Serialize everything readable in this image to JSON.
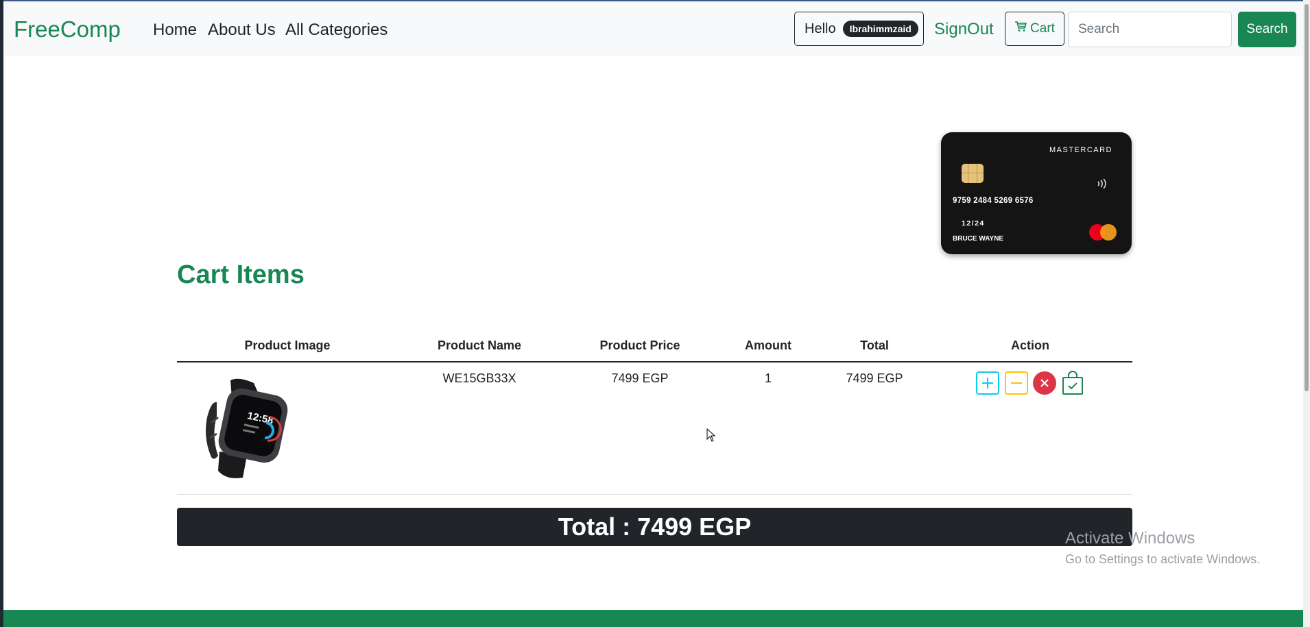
{
  "navbar": {
    "brand": "FreeComp",
    "links": [
      "Home",
      "About Us",
      "All Categories"
    ],
    "hello_label": "Hello",
    "username": "Ibrahimmzaid",
    "signout_label": "SignOut",
    "cart_label": "Cart",
    "search_placeholder": "Search",
    "search_button": "Search"
  },
  "card": {
    "brand": "MASTERCARD",
    "number": "9759 2484 5269 6576",
    "expiry": "12/24",
    "holder": "BRUCE WAYNE"
  },
  "cart": {
    "title": "Cart Items",
    "columns": [
      "Product Image",
      "Product Name",
      "Product Price",
      "Amount",
      "Total",
      "Action"
    ],
    "rows": [
      {
        "name": "WE15GB33X",
        "price": "7499 EGP",
        "amount": "1",
        "total": "7499 EGP",
        "image": "smartwatch-image"
      }
    ],
    "total_label": "Total : 7499 EGP"
  },
  "watermark": {
    "line1": "Activate Windows",
    "line2": "Go to Settings to activate Windows."
  },
  "icons": [
    "cart-icon",
    "contactless-icon",
    "mastercard-logo",
    "plus-icon",
    "minus-icon",
    "remove-icon",
    "checkout-bag-icon",
    "cursor-icon"
  ],
  "colors": {
    "brand_green": "#198754",
    "info": "#0dcaf0",
    "warning": "#ffc107",
    "danger": "#dc3545",
    "dark": "#212529"
  }
}
